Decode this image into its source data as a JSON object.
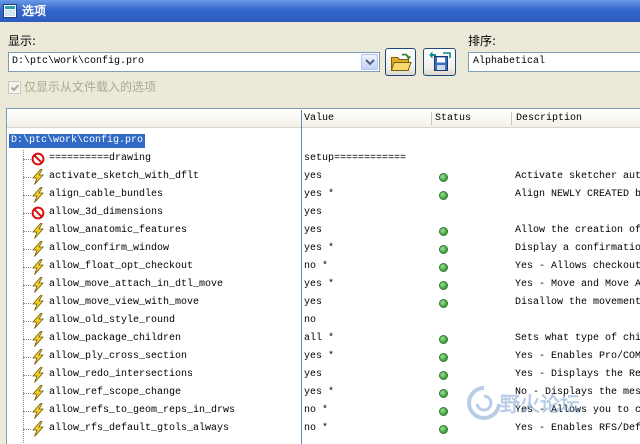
{
  "window": {
    "title": "选项",
    "icon": "window-icon"
  },
  "display": {
    "label": "显示:",
    "value": "D:\\ptc\\work\\config.pro"
  },
  "toolbar": {
    "open_icon": "open-folder-icon",
    "save_icon": "save-disk-icon"
  },
  "sort": {
    "label": "排序:",
    "value": "Alphabetical"
  },
  "filter": {
    "label": "仅显示从文件载入的选项",
    "checked": true,
    "disabled": true
  },
  "table": {
    "columns": {
      "value": "Value",
      "status": "Status",
      "description": "Description"
    },
    "root": "D:\\ptc\\work\\config.pro",
    "rows": [
      {
        "name": "==========drawing",
        "icon": "prohibited-icon",
        "value": "setup============",
        "status_dot": false,
        "description": ""
      },
      {
        "name": "activate_sketch_with_dflt",
        "icon": "lightning-icon",
        "value": "yes",
        "status_dot": true,
        "description": "Activate sketcher aut"
      },
      {
        "name": "align_cable_bundles",
        "icon": "lightning-icon",
        "value": "yes *",
        "status_dot": true,
        "description": "Align NEWLY CREATED b"
      },
      {
        "name": "allow_3d_dimensions",
        "icon": "prohibited-icon",
        "value": "yes",
        "status_dot": false,
        "description": ""
      },
      {
        "name": "allow_anatomic_features",
        "icon": "lightning-icon",
        "value": "yes",
        "status_dot": true,
        "description": "Allow the creation of"
      },
      {
        "name": "allow_confirm_window",
        "icon": "lightning-icon",
        "value": "yes *",
        "status_dot": true,
        "description": "Display a confirmatio"
      },
      {
        "name": "allow_float_opt_checkout",
        "icon": "lightning-icon",
        "value": "no *",
        "status_dot": true,
        "description": "Yes - Allows checkout"
      },
      {
        "name": "allow_move_attach_in_dtl_move",
        "icon": "lightning-icon",
        "value": "yes *",
        "status_dot": true,
        "description": "Yes - Move and Move A"
      },
      {
        "name": "allow_move_view_with_move",
        "icon": "lightning-icon",
        "value": "yes",
        "status_dot": true,
        "description": "Disallow the movement"
      },
      {
        "name": "allow_old_style_round",
        "icon": "lightning-icon",
        "value": "no",
        "status_dot": false,
        "description": ""
      },
      {
        "name": "allow_package_children",
        "icon": "lightning-icon",
        "value": "all *",
        "status_dot": true,
        "description": "Sets what type of chi"
      },
      {
        "name": "allow_ply_cross_section",
        "icon": "lightning-icon",
        "value": "yes *",
        "status_dot": true,
        "description": "Yes - Enables Pro/COM"
      },
      {
        "name": "allow_redo_intersections",
        "icon": "lightning-icon",
        "value": "yes",
        "status_dot": true,
        "description": "Yes - Displays the Re"
      },
      {
        "name": "allow_ref_scope_change",
        "icon": "lightning-icon",
        "value": "yes *",
        "status_dot": true,
        "description": "No - Displays the mes"
      },
      {
        "name": "allow_refs_to_geom_reps_in_drws",
        "icon": "lightning-icon",
        "value": "no *",
        "status_dot": true,
        "description": "Yes - Allows you to c"
      },
      {
        "name": "allow_rfs_default_gtols_always",
        "icon": "lightning-icon",
        "value": "no *",
        "status_dot": true,
        "description": "Yes - Enables RFS/Def"
      }
    ]
  },
  "watermark": {
    "text": "野火论坛"
  },
  "colors": {
    "selection": "#316ac5",
    "status_ok": "#3e9e3e",
    "title_bar": "#3567cc"
  }
}
